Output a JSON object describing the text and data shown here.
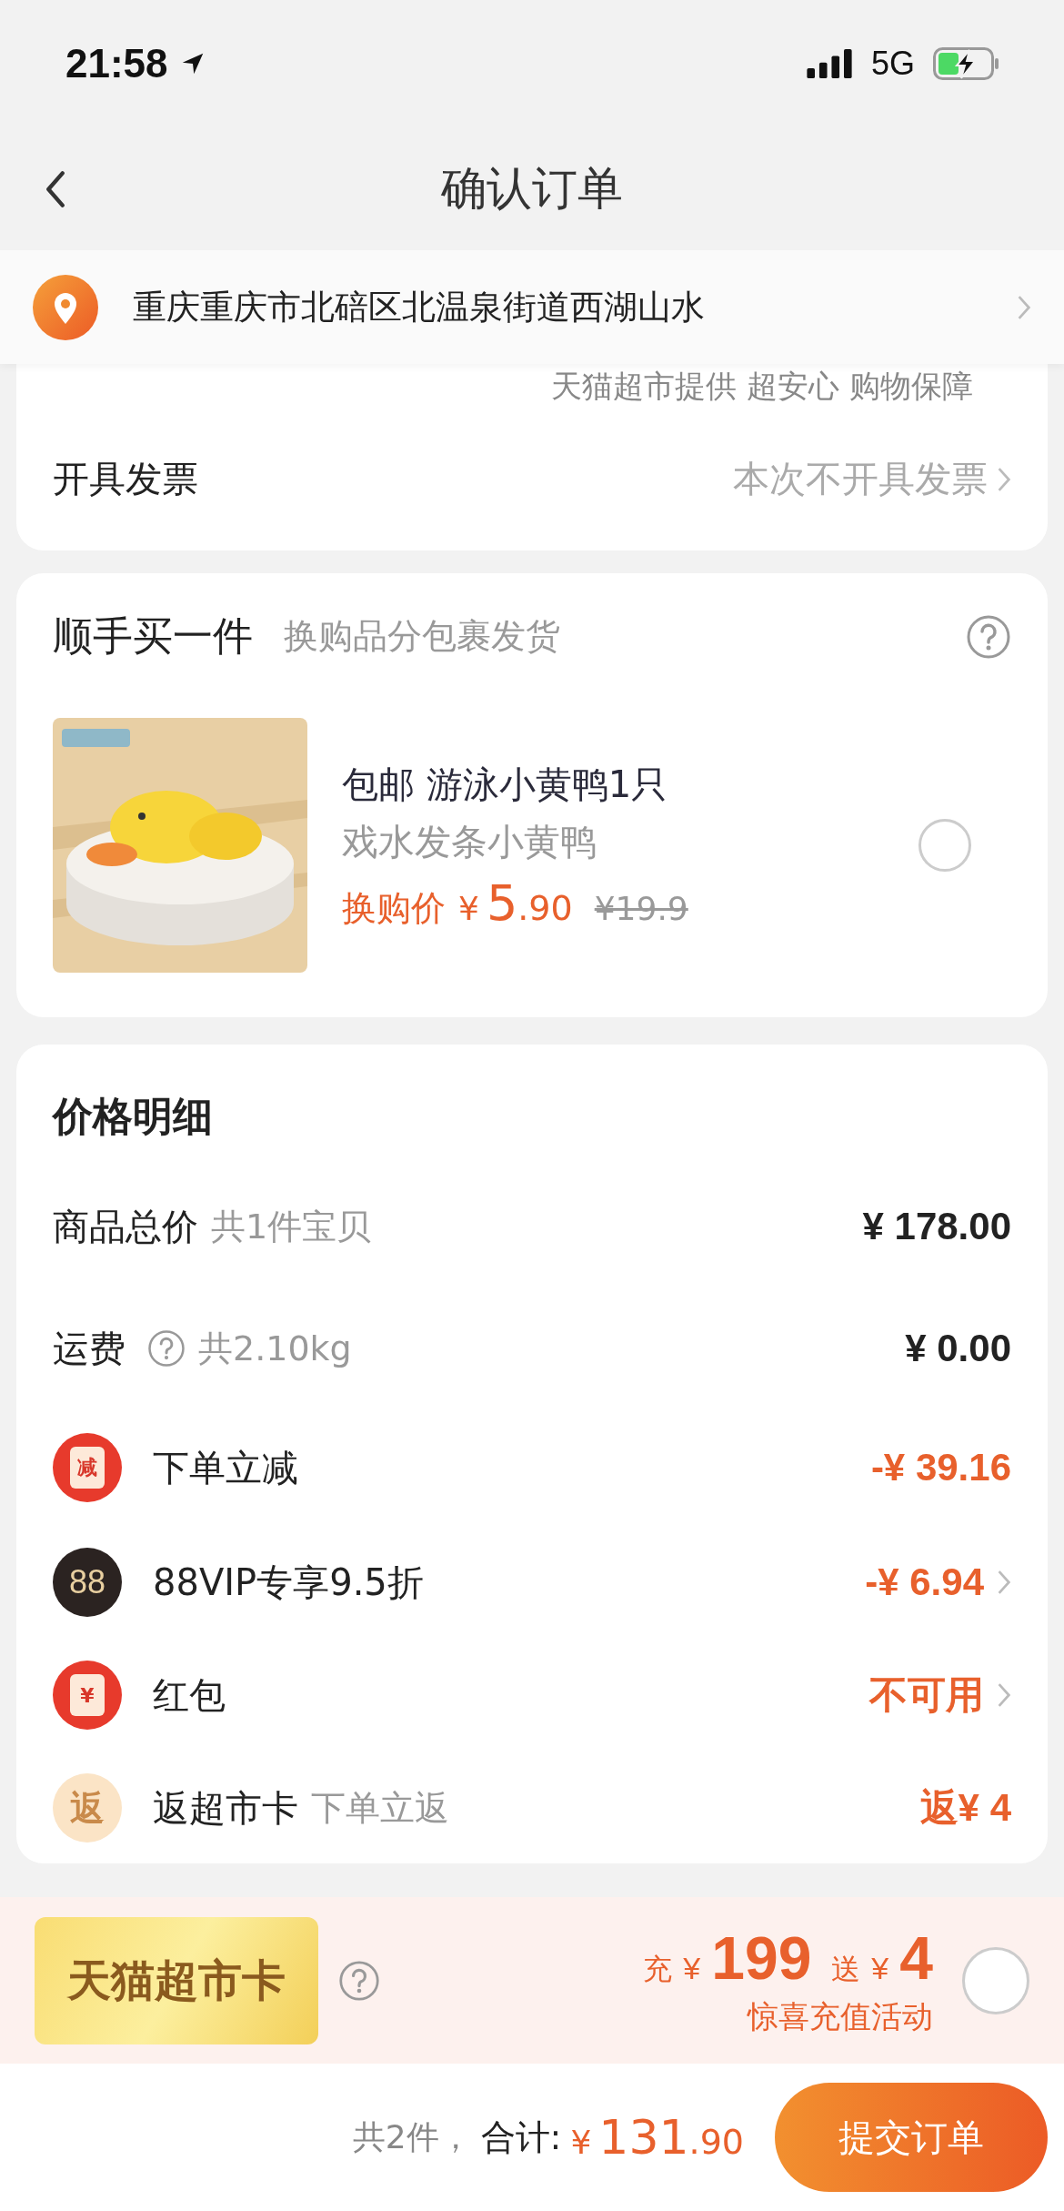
{
  "status_bar": {
    "time": "21:58",
    "network": "5G"
  },
  "nav": {
    "title": "确认订单"
  },
  "address": {
    "text": "重庆重庆市北碚区北温泉街道西湖山水"
  },
  "order_card": {
    "guarantee": "天猫超市提供 超安心 购物保障",
    "invoice": {
      "label": "开具发票",
      "value": "本次不开具发票"
    }
  },
  "add_on": {
    "title": "顺手买一件",
    "subtitle": "换购品分包裹发货",
    "product": {
      "title": "包邮 游泳小黄鸭1只",
      "subtitle": "戏水发条小黄鸭",
      "price_label": "换购价",
      "currency": "¥",
      "price_int": "5",
      "price_dec": ".90",
      "original_price": "¥19.9",
      "selected": false
    }
  },
  "price_detail": {
    "title": "价格明细",
    "rows": [
      {
        "kind": "plain",
        "label": "商品总价",
        "note": "共1件宝贝",
        "help": false,
        "value": "¥ 178.00",
        "accent": false,
        "arrow": false
      },
      {
        "kind": "plain",
        "label": "运费",
        "note": "共2.10kg",
        "help": true,
        "value": "¥ 0.00",
        "accent": false,
        "arrow": false
      },
      {
        "kind": "reduction",
        "badge": "减",
        "label": "下单立减",
        "help": false,
        "value": "-¥ 39.16",
        "accent": true,
        "arrow": false
      },
      {
        "kind": "vip",
        "badge": "88",
        "label": "88VIP专享9.5折",
        "help": false,
        "value": "-¥ 6.94",
        "accent": true,
        "arrow": true
      },
      {
        "kind": "redpacket",
        "badge": "¥",
        "label": "红包",
        "help": false,
        "value": "不可用",
        "accent": true,
        "arrow": true
      },
      {
        "kind": "cashback",
        "badge": "返",
        "label": "返超市卡",
        "note": "下单立返",
        "help": false,
        "value": "返¥ 4",
        "accent": true,
        "arrow": false
      }
    ]
  },
  "tmall_card": {
    "name": "天猫超市卡",
    "recharge_label": "充",
    "currency": "¥",
    "amount": "199",
    "bonus_label": "送",
    "bonus": "4",
    "activity": "惊喜充值活动",
    "selected": false
  },
  "footer": {
    "count": "共2件，",
    "total_label": "合计:",
    "currency": "¥",
    "total_int": "131",
    "total_dec": ".90",
    "submit": "提交订单"
  }
}
